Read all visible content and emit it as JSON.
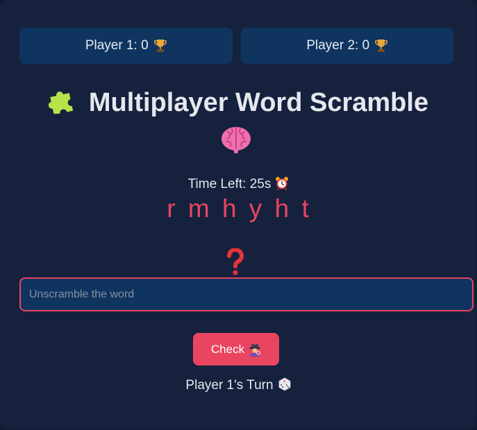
{
  "scoreboard": {
    "player1_label": "Player 1: 0",
    "player2_label": "Player 2: 0",
    "icon": "trophy-icon"
  },
  "title": {
    "text": "Multiplayer Word Scramble",
    "leading_icon": "puzzle-piece-icon",
    "trailing_icon": "brain-icon"
  },
  "timer": {
    "text": "Time Left: 25s",
    "icon": "alarm-clock-icon"
  },
  "scrambled_word": "r m h y h t",
  "hint_icon": "question-mark-icon",
  "answer": {
    "value": "",
    "placeholder": "Unscramble the word"
  },
  "check_button": {
    "label": "Check",
    "icon": "detective-icon"
  },
  "turn": {
    "text": "Player 1's Turn",
    "icon": "die-icon"
  },
  "colors": {
    "background": "#16213e",
    "panel": "#0f3460",
    "accent": "#e94560",
    "text": "#e6e8ee",
    "puzzle": "#b6e34a",
    "brain": "#f06fb0"
  }
}
